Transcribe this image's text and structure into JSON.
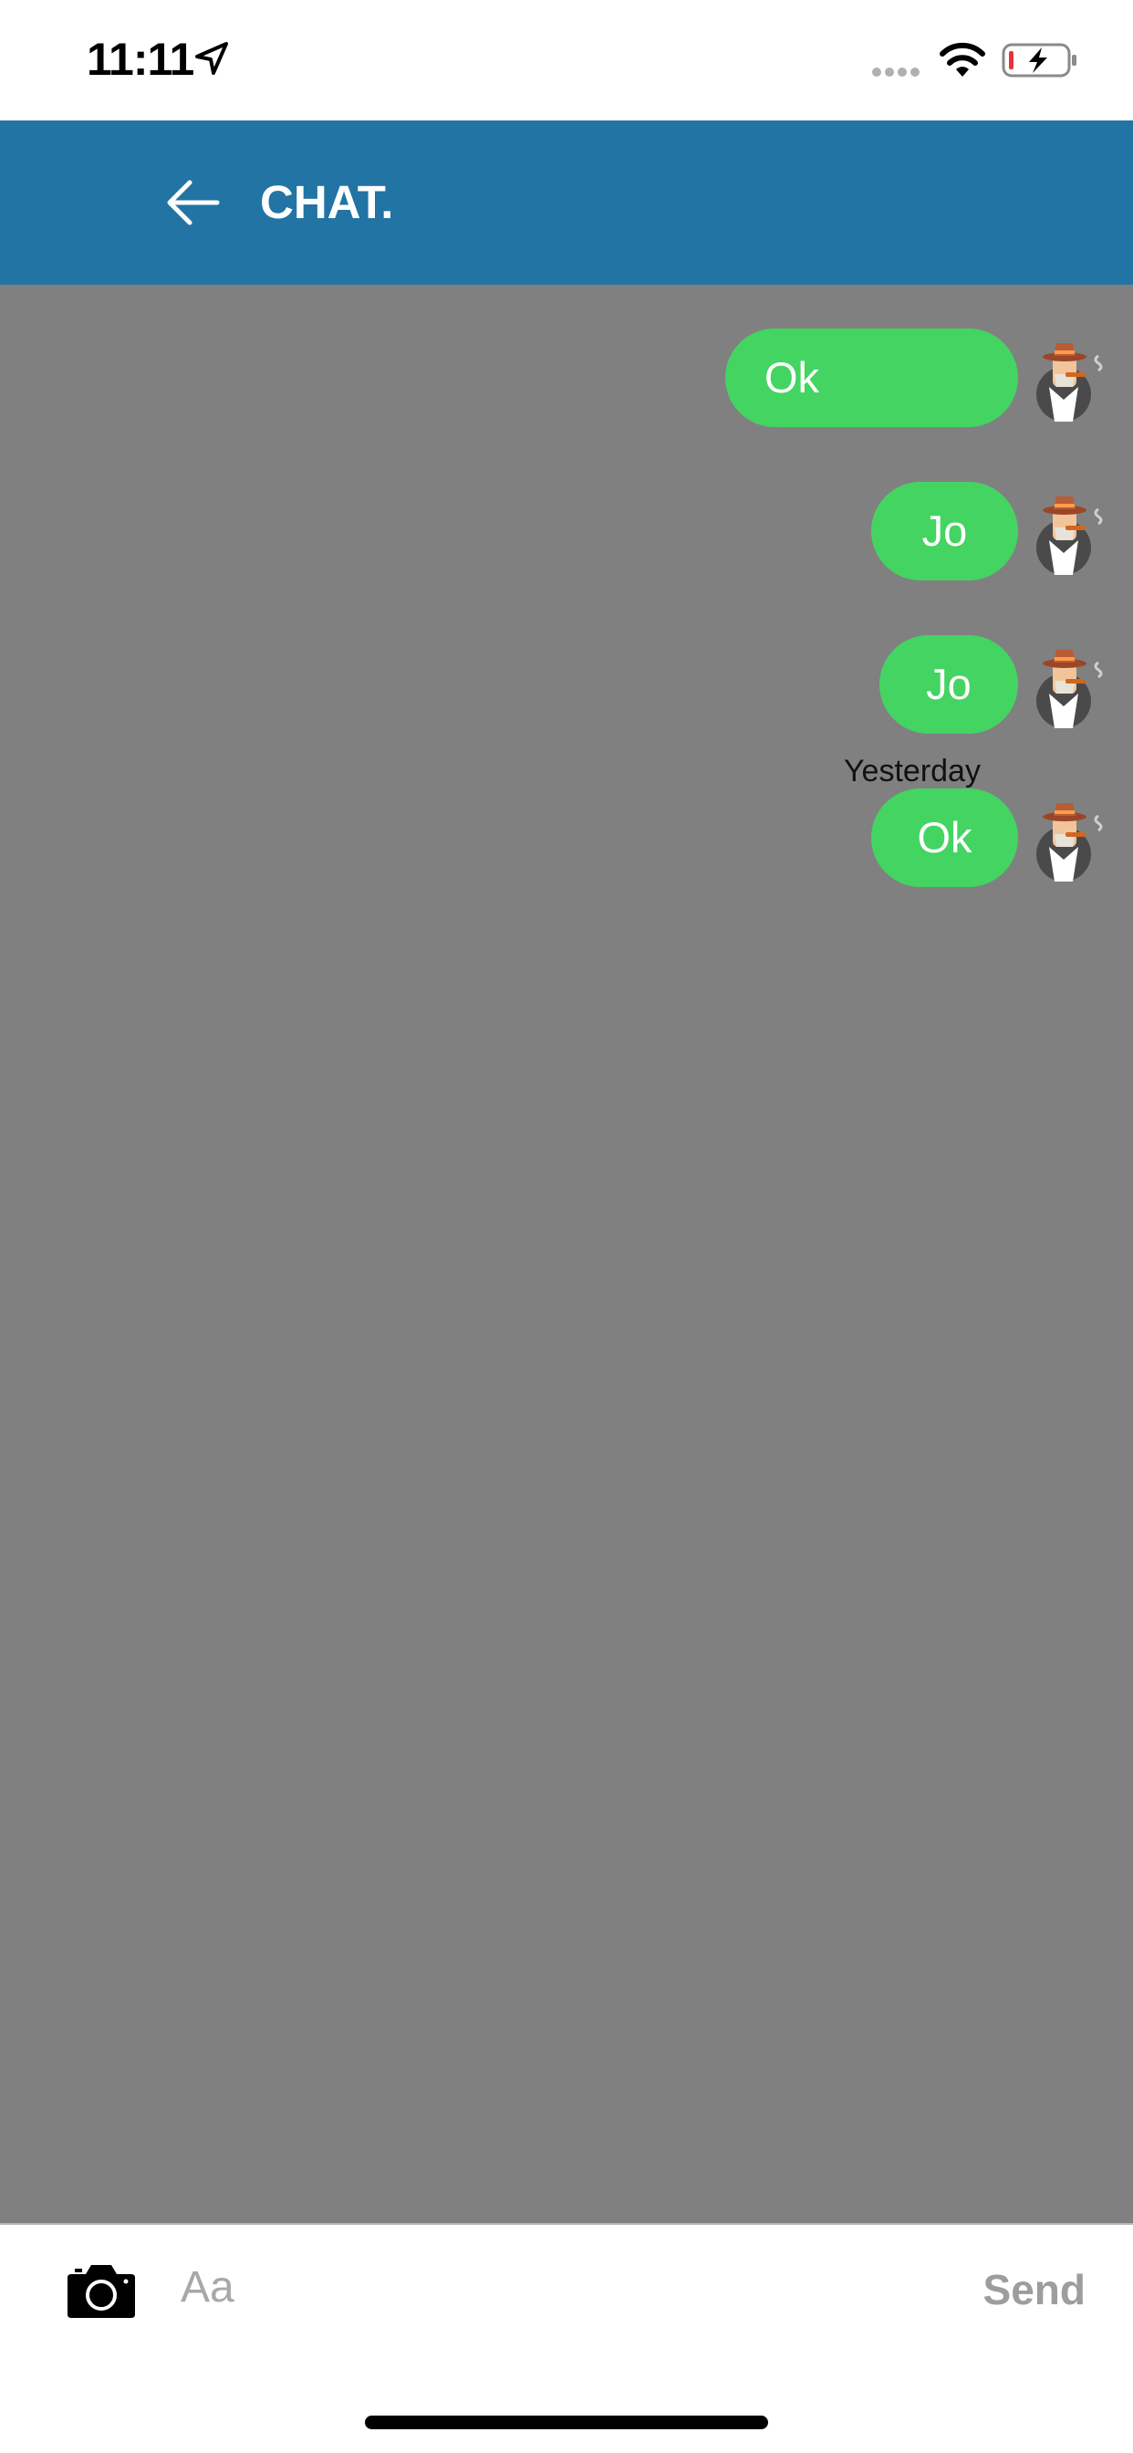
{
  "status_bar": {
    "time": "11:11"
  },
  "header": {
    "title": "CHAT."
  },
  "messages": [
    {
      "text": "Ok",
      "date_label": ""
    },
    {
      "text": "Jo",
      "date_label": ""
    },
    {
      "text": "Jo",
      "date_label": ""
    },
    {
      "text": "Ok",
      "date_label": "Yesterday"
    }
  ],
  "composer": {
    "placeholder": "Aa",
    "send_label": "Send"
  },
  "colors": {
    "header_bg": "#2274a5",
    "bubble_bg": "#44d462",
    "chat_bg": "#808080",
    "send_disabled": "#9d9d9d"
  }
}
